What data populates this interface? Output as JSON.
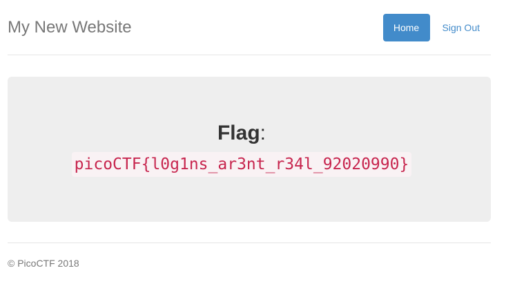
{
  "header": {
    "brand": "My New Website",
    "nav": {
      "home_label": "Home",
      "signout_label": "Sign Out"
    }
  },
  "main": {
    "flag_label": "Flag",
    "flag_colon": ":",
    "flag_value": "picoCTF{l0g1ns_ar3nt_r34l_92020990}"
  },
  "footer": {
    "text": "© PicoCTF 2018"
  },
  "colors": {
    "primary": "#428bca",
    "jumbotron_bg": "#eeeeee",
    "code_text": "#c7254e",
    "code_bg": "#f9f2f4",
    "muted_text": "#777777"
  }
}
